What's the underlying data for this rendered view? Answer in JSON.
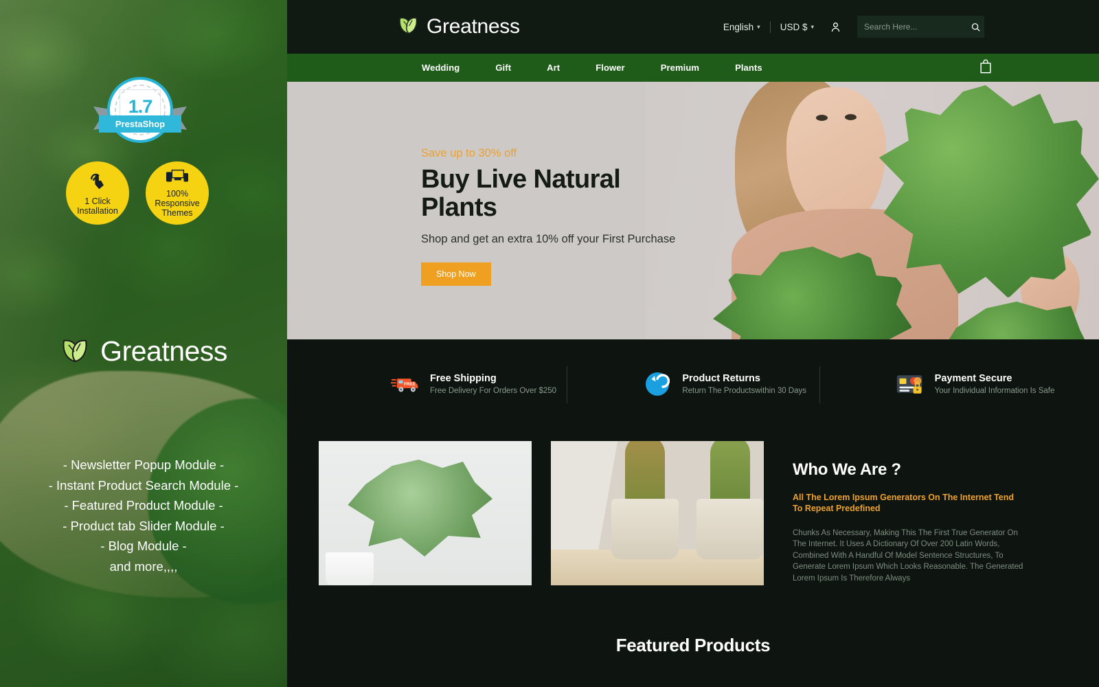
{
  "promo": {
    "badge": {
      "version": "1.7",
      "ribbon": "PrestaShop",
      "name": "prestashop-badge"
    },
    "features": [
      {
        "icon": "click-cursor-icon",
        "label": "1 Click\nInstallation"
      },
      {
        "icon": "devices-responsive-icon",
        "label": "100%\nResponsive\nThemes"
      }
    ],
    "brand": "Greatness",
    "modules": [
      "- Newsletter Popup Module -",
      "- Instant Product Search Module -",
      "- Featured Product Module -",
      "- Product tab Slider Module -",
      "- Blog Module -",
      "and more,,,,"
    ]
  },
  "header": {
    "brand": "Greatness",
    "language": "English",
    "currency": "USD $",
    "account_icon": "user-icon",
    "search": {
      "placeholder": "Search Here...",
      "value": "",
      "icon": "search-icon"
    }
  },
  "nav": {
    "items": [
      {
        "label": "Wedding"
      },
      {
        "label": "Gift"
      },
      {
        "label": "Art"
      },
      {
        "label": "Flower"
      },
      {
        "label": "Premium"
      },
      {
        "label": "Plants"
      }
    ],
    "cart_icon": "shopping-bag-icon"
  },
  "hero": {
    "eyebrow": "Save up to 30% off",
    "title": "Buy Live Natural Plants",
    "subtitle": "Shop and get an extra 10% off your First Purchase",
    "cta": "Shop Now"
  },
  "services": [
    {
      "icon": "delivery-truck-icon",
      "title": "Free Shipping",
      "subtitle": "Free Delivery For Orders Over $250"
    },
    {
      "icon": "return-arrow-icon",
      "title": "Product Returns",
      "subtitle": "Return The Productswithin 30 Days"
    },
    {
      "icon": "credit-card-lock-icon",
      "title": "Payment Secure",
      "subtitle": "Your Individual Information Is Safe"
    }
  ],
  "about": {
    "title": "Who We Are ?",
    "lead": "All The Lorem Ipsum Generators On The Internet Tend To Repeat Predefined",
    "body": "Chunks As Necessary, Making This The First True Generator On The Internet. It Uses A Dictionary Of Over 200 Latin Words, Combined With A Handful Of Model Sentence Structures, To Generate Lorem Ipsum Which Looks Reasonable. The Generated Lorem Ipsum Is Therefore Always"
  },
  "featured": {
    "title": "Featured Products"
  },
  "colors": {
    "dark_bg": "#0e1510",
    "header_bg": "#101a12",
    "nav_green": "#1f5c19",
    "accent_orange": "#eda12f",
    "cta_orange": "#f0a020",
    "hero_bg": "#cdc9c7",
    "badge_blue": "#2fb8da",
    "feature_yellow": "#f5d312"
  }
}
